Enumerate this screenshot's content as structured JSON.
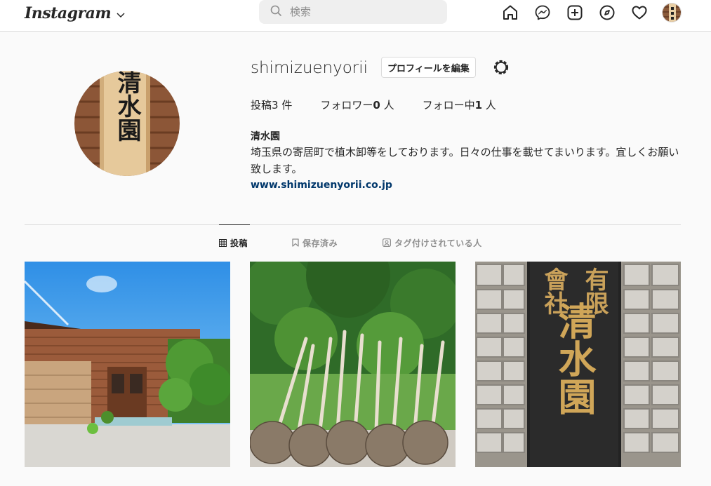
{
  "header": {
    "logo_text": "Instagram",
    "search_placeholder": "検索"
  },
  "profile": {
    "username": "shimizuenyorii",
    "edit_button": "プロフィールを編集",
    "stats": [
      {
        "label": "投稿",
        "count": "3",
        "unit": " 件"
      },
      {
        "label": "フォロワー",
        "count": "0",
        "unit": " 人"
      },
      {
        "label": "フォロー中",
        "count": "1",
        "unit": " 人"
      }
    ],
    "display_name": "清水園",
    "bio": "埼玉県の寄居町で植木卸等をしております。日々の仕事を載せてまいります。宜しくお願い致します。",
    "website": "www.shimizuenyorii.co.jp",
    "sign_text": "清水園"
  },
  "tabs": [
    {
      "label": "投稿",
      "icon": "grid-icon"
    },
    {
      "label": "保存済み",
      "icon": "bookmark-icon"
    },
    {
      "label": "タグ付けされている人",
      "icon": "tag-user-icon"
    }
  ],
  "posts": {
    "sign_lines": [
      "有限",
      "會社",
      "清水園"
    ]
  },
  "colors": {
    "link": "#00376b",
    "border": "#dbdbdb",
    "muted": "#8e8e8e"
  }
}
